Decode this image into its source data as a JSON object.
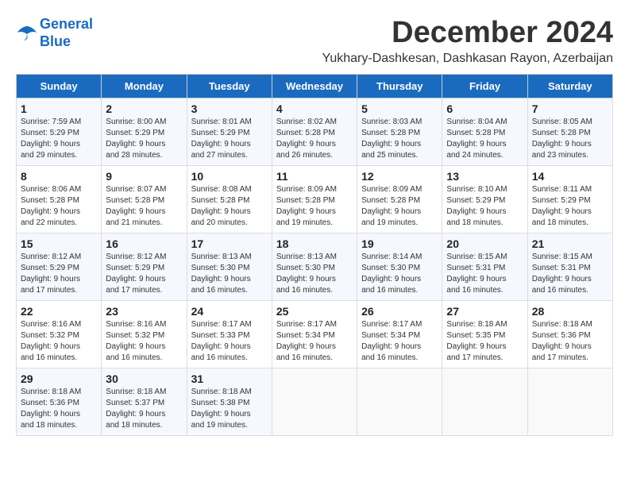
{
  "header": {
    "logo_line1": "General",
    "logo_line2": "Blue",
    "month": "December 2024",
    "location": "Yukhary-Dashkesan, Dashkasan Rayon, Azerbaijan"
  },
  "weekdays": [
    "Sunday",
    "Monday",
    "Tuesday",
    "Wednesday",
    "Thursday",
    "Friday",
    "Saturday"
  ],
  "weeks": [
    [
      {
        "day": "1",
        "lines": [
          "Sunrise: 7:59 AM",
          "Sunset: 5:29 PM",
          "Daylight: 9 hours",
          "and 29 minutes."
        ]
      },
      {
        "day": "2",
        "lines": [
          "Sunrise: 8:00 AM",
          "Sunset: 5:29 PM",
          "Daylight: 9 hours",
          "and 28 minutes."
        ]
      },
      {
        "day": "3",
        "lines": [
          "Sunrise: 8:01 AM",
          "Sunset: 5:29 PM",
          "Daylight: 9 hours",
          "and 27 minutes."
        ]
      },
      {
        "day": "4",
        "lines": [
          "Sunrise: 8:02 AM",
          "Sunset: 5:28 PM",
          "Daylight: 9 hours",
          "and 26 minutes."
        ]
      },
      {
        "day": "5",
        "lines": [
          "Sunrise: 8:03 AM",
          "Sunset: 5:28 PM",
          "Daylight: 9 hours",
          "and 25 minutes."
        ]
      },
      {
        "day": "6",
        "lines": [
          "Sunrise: 8:04 AM",
          "Sunset: 5:28 PM",
          "Daylight: 9 hours",
          "and 24 minutes."
        ]
      },
      {
        "day": "7",
        "lines": [
          "Sunrise: 8:05 AM",
          "Sunset: 5:28 PM",
          "Daylight: 9 hours",
          "and 23 minutes."
        ]
      }
    ],
    [
      {
        "day": "8",
        "lines": [
          "Sunrise: 8:06 AM",
          "Sunset: 5:28 PM",
          "Daylight: 9 hours",
          "and 22 minutes."
        ]
      },
      {
        "day": "9",
        "lines": [
          "Sunrise: 8:07 AM",
          "Sunset: 5:28 PM",
          "Daylight: 9 hours",
          "and 21 minutes."
        ]
      },
      {
        "day": "10",
        "lines": [
          "Sunrise: 8:08 AM",
          "Sunset: 5:28 PM",
          "Daylight: 9 hours",
          "and 20 minutes."
        ]
      },
      {
        "day": "11",
        "lines": [
          "Sunrise: 8:09 AM",
          "Sunset: 5:28 PM",
          "Daylight: 9 hours",
          "and 19 minutes."
        ]
      },
      {
        "day": "12",
        "lines": [
          "Sunrise: 8:09 AM",
          "Sunset: 5:28 PM",
          "Daylight: 9 hours",
          "and 19 minutes."
        ]
      },
      {
        "day": "13",
        "lines": [
          "Sunrise: 8:10 AM",
          "Sunset: 5:29 PM",
          "Daylight: 9 hours",
          "and 18 minutes."
        ]
      },
      {
        "day": "14",
        "lines": [
          "Sunrise: 8:11 AM",
          "Sunset: 5:29 PM",
          "Daylight: 9 hours",
          "and 18 minutes."
        ]
      }
    ],
    [
      {
        "day": "15",
        "lines": [
          "Sunrise: 8:12 AM",
          "Sunset: 5:29 PM",
          "Daylight: 9 hours",
          "and 17 minutes."
        ]
      },
      {
        "day": "16",
        "lines": [
          "Sunrise: 8:12 AM",
          "Sunset: 5:29 PM",
          "Daylight: 9 hours",
          "and 17 minutes."
        ]
      },
      {
        "day": "17",
        "lines": [
          "Sunrise: 8:13 AM",
          "Sunset: 5:30 PM",
          "Daylight: 9 hours",
          "and 16 minutes."
        ]
      },
      {
        "day": "18",
        "lines": [
          "Sunrise: 8:13 AM",
          "Sunset: 5:30 PM",
          "Daylight: 9 hours",
          "and 16 minutes."
        ]
      },
      {
        "day": "19",
        "lines": [
          "Sunrise: 8:14 AM",
          "Sunset: 5:30 PM",
          "Daylight: 9 hours",
          "and 16 minutes."
        ]
      },
      {
        "day": "20",
        "lines": [
          "Sunrise: 8:15 AM",
          "Sunset: 5:31 PM",
          "Daylight: 9 hours",
          "and 16 minutes."
        ]
      },
      {
        "day": "21",
        "lines": [
          "Sunrise: 8:15 AM",
          "Sunset: 5:31 PM",
          "Daylight: 9 hours",
          "and 16 minutes."
        ]
      }
    ],
    [
      {
        "day": "22",
        "lines": [
          "Sunrise: 8:16 AM",
          "Sunset: 5:32 PM",
          "Daylight: 9 hours",
          "and 16 minutes."
        ]
      },
      {
        "day": "23",
        "lines": [
          "Sunrise: 8:16 AM",
          "Sunset: 5:32 PM",
          "Daylight: 9 hours",
          "and 16 minutes."
        ]
      },
      {
        "day": "24",
        "lines": [
          "Sunrise: 8:17 AM",
          "Sunset: 5:33 PM",
          "Daylight: 9 hours",
          "and 16 minutes."
        ]
      },
      {
        "day": "25",
        "lines": [
          "Sunrise: 8:17 AM",
          "Sunset: 5:34 PM",
          "Daylight: 9 hours",
          "and 16 minutes."
        ]
      },
      {
        "day": "26",
        "lines": [
          "Sunrise: 8:17 AM",
          "Sunset: 5:34 PM",
          "Daylight: 9 hours",
          "and 16 minutes."
        ]
      },
      {
        "day": "27",
        "lines": [
          "Sunrise: 8:18 AM",
          "Sunset: 5:35 PM",
          "Daylight: 9 hours",
          "and 17 minutes."
        ]
      },
      {
        "day": "28",
        "lines": [
          "Sunrise: 8:18 AM",
          "Sunset: 5:36 PM",
          "Daylight: 9 hours",
          "and 17 minutes."
        ]
      }
    ],
    [
      {
        "day": "29",
        "lines": [
          "Sunrise: 8:18 AM",
          "Sunset: 5:36 PM",
          "Daylight: 9 hours",
          "and 18 minutes."
        ]
      },
      {
        "day": "30",
        "lines": [
          "Sunrise: 8:18 AM",
          "Sunset: 5:37 PM",
          "Daylight: 9 hours",
          "and 18 minutes."
        ]
      },
      {
        "day": "31",
        "lines": [
          "Sunrise: 8:18 AM",
          "Sunset: 5:38 PM",
          "Daylight: 9 hours",
          "and 19 minutes."
        ]
      },
      {
        "day": "",
        "lines": []
      },
      {
        "day": "",
        "lines": []
      },
      {
        "day": "",
        "lines": []
      },
      {
        "day": "",
        "lines": []
      }
    ]
  ]
}
